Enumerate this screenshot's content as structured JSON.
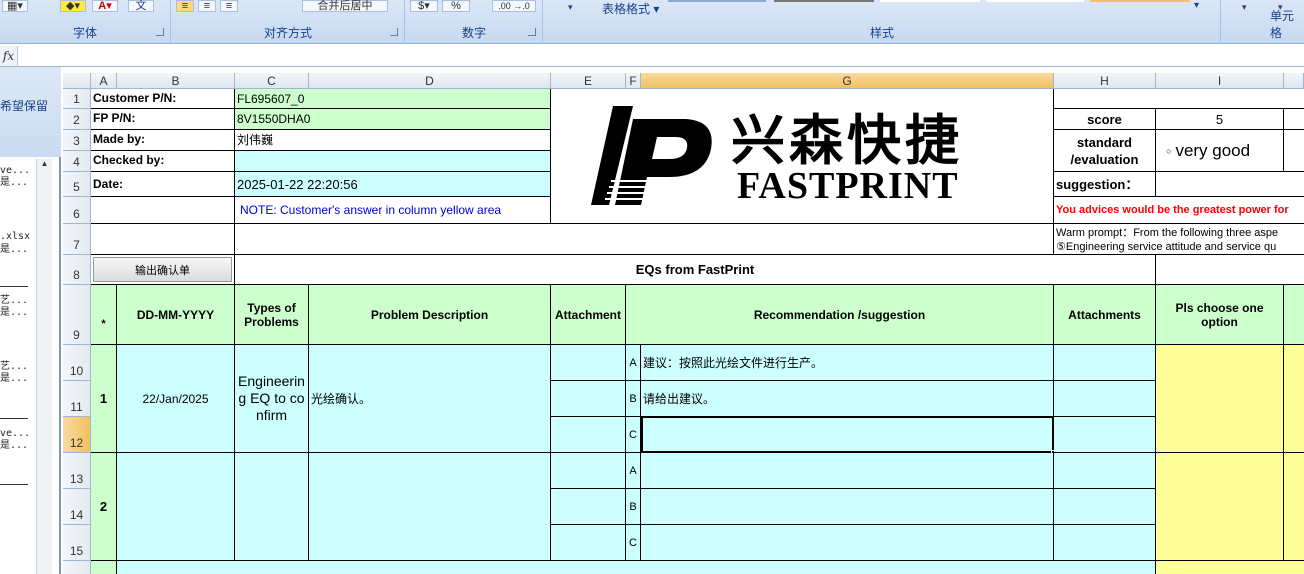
{
  "ribbon": {
    "groups": [
      {
        "label": "字体"
      },
      {
        "label": "对齐方式"
      },
      {
        "label": "数字"
      },
      {
        "label": "样式"
      },
      {
        "label": "单元格"
      }
    ],
    "merge_label": "合并后居中",
    "table_format_label": "表格格式",
    "percent_label": "%",
    "decimal_inc_label": ".00 →.0",
    "font_char": "文"
  },
  "formula_bar": {
    "fx": "fx",
    "value": ""
  },
  "left_pane": {
    "title": "希望保留",
    "lines": [
      "ve...",
      "是...",
      ".xlsx",
      "是...",
      "艺...",
      "是...",
      "艺...",
      "是...",
      "ve...",
      "是..."
    ]
  },
  "columns": [
    "A",
    "B",
    "C",
    "D",
    "E",
    "F",
    "G",
    "H",
    "I"
  ],
  "rows": [
    "1",
    "2",
    "3",
    "4",
    "5",
    "6",
    "7",
    "8",
    "9",
    "10",
    "11",
    "12",
    "13",
    "14",
    "15"
  ],
  "header": {
    "customer_pn_label": "Customer P/N:",
    "customer_pn": "FL695607_0",
    "fp_pn_label": "FP P/N:",
    "fp_pn": "8V1550DHA0",
    "made_by_label": "Made by:",
    "made_by": "刘伟巍",
    "checked_by_label": "Checked by:",
    "checked_by": "",
    "date_label": "Date:",
    "date": "2025-01-22 22:20:56",
    "note": "NOTE: Customer's  answer in column yellow area",
    "logo_cn": "兴森快捷",
    "logo_en": "FASTPRINT",
    "score_label": "score",
    "score": "5",
    "standard_label": "standard /evaluation",
    "evaluation": "very good",
    "suggestion_label": "suggestion：",
    "advice": "You advices would be the greatest power for",
    "warm_prompt": "Warm prompt：From the following three aspe",
    "warm_prompt_2": "⑤Engineering service attitude and service qu",
    "export_button": "输出确认单",
    "eq_title": "EQs from FastPrint"
  },
  "table_headers": {
    "star": "*",
    "date": "DD-MM-YYYY",
    "types": "Types of Problems",
    "description": "Problem Description",
    "attachment": "Attachment",
    "recommendation": "Recommendation /suggestion",
    "attachments": "Attachments",
    "choose": "Pls choose one option"
  },
  "eqs": [
    {
      "no": "1",
      "date": "22/Jan/2025",
      "type": "Engineering EQ to confirm",
      "description": "光绘确认。",
      "options": [
        {
          "letter": "A",
          "text": "建议：按照此光绘文件进行生产。"
        },
        {
          "letter": "B",
          "text": "请给出建议。"
        },
        {
          "letter": "C",
          "text": ""
        }
      ]
    },
    {
      "no": "2",
      "date": "",
      "type": "",
      "description": "",
      "options": [
        {
          "letter": "A",
          "text": ""
        },
        {
          "letter": "B",
          "text": ""
        },
        {
          "letter": "C",
          "text": ""
        }
      ]
    }
  ],
  "colors": {
    "green": "#ccffcc",
    "cyan": "#ccffff",
    "yellow": "#ffff99",
    "advice_red": "#ff0000",
    "note_blue": "#0000cc"
  }
}
